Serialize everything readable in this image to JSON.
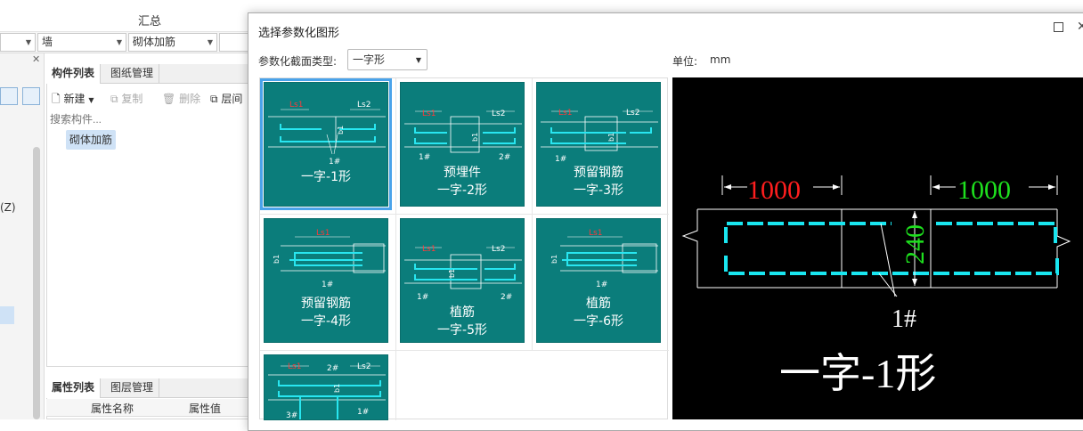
{
  "background": {
    "summary_label": "汇总",
    "combos": [
      "墙",
      "砌体加筋"
    ],
    "side_label": "(Z)",
    "component_panel": {
      "tabs": [
        "构件列表",
        "图纸管理"
      ],
      "tools": [
        "新建",
        "复制",
        "删除",
        "层间"
      ],
      "search_placeholder": "搜索构件...",
      "items": [
        "砌体加筋"
      ]
    },
    "property_panel": {
      "tabs": [
        "属性列表",
        "图层管理"
      ],
      "columns": [
        "属性名称",
        "属性值"
      ]
    }
  },
  "dialog": {
    "title": "选择参数化图形",
    "section_type_label": "参数化截面类型:",
    "section_type_value": "一字形",
    "unit_label": "单位:",
    "unit_value": "mm",
    "tiles": [
      {
        "lines": [
          "一字-1形"
        ],
        "selected": true
      },
      {
        "lines": [
          "预埋件",
          "一字-2形"
        ]
      },
      {
        "lines": [
          "预留钢筋",
          "一字-3形"
        ]
      },
      {
        "lines": [
          "预留钢筋",
          "一字-4形"
        ]
      },
      {
        "lines": [
          "植筋",
          "一字-5形"
        ]
      },
      {
        "lines": [
          "植筋",
          "一字-6形"
        ]
      },
      {
        "lines": [
          ""
        ]
      }
    ],
    "tile_labels": {
      "ls1": "Ls1",
      "ls2": "Ls2",
      "b1": "b1",
      "n1": "1#",
      "n2": "2#",
      "n3": "3#"
    },
    "preview": {
      "left_length": "1000",
      "right_length": "1000",
      "thickness": "240",
      "bar_label": "1#",
      "shape_name": "一字-1形",
      "colors": {
        "left": "#ff1e1e",
        "right": "#1ee01e",
        "bar": "#19e6f0",
        "line": "#ffffff"
      }
    }
  }
}
